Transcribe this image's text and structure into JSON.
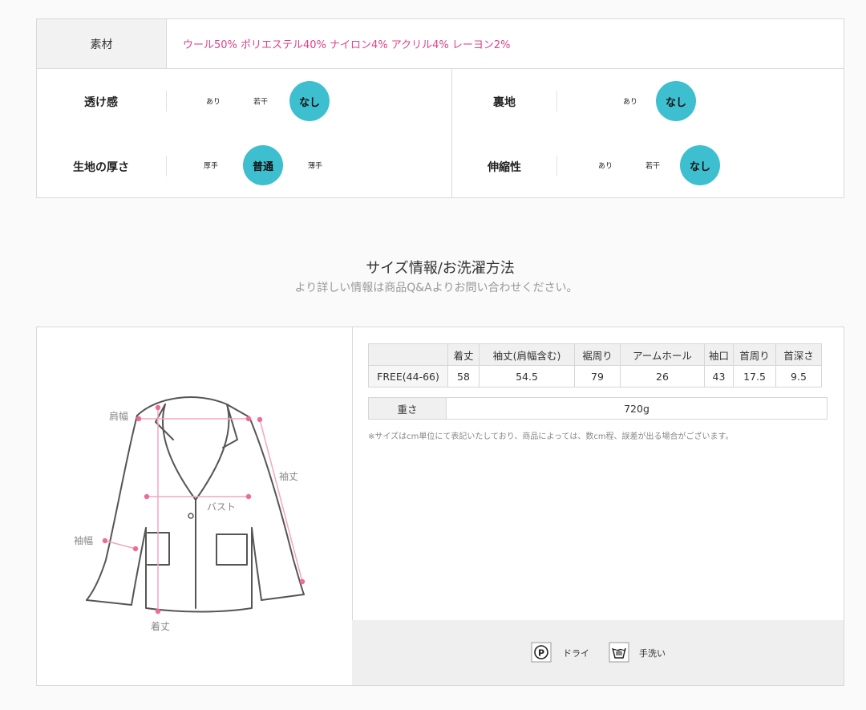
{
  "material": {
    "label": "素材",
    "value": "ウール50% ポリエステル40% ナイロン4% アクリル4% レーヨン2%"
  },
  "attributes": [
    {
      "label": "透け感",
      "options": [
        "あり",
        "若干",
        "なし"
      ],
      "selected": "なし"
    },
    {
      "label": "裏地",
      "options": [
        "あり",
        "なし"
      ],
      "selected": "なし"
    },
    {
      "label": "生地の厚さ",
      "options": [
        "厚手",
        "普通",
        "薄手"
      ],
      "selected": "普通"
    },
    {
      "label": "伸縮性",
      "options": [
        "あり",
        "若干",
        "なし"
      ],
      "selected": "なし"
    }
  ],
  "section": {
    "title": "サイズ情報/お洗濯方法",
    "subtitle": "より詳しい情報は商品Q&Aよりお問い合わせください。"
  },
  "diagram_labels": {
    "shoulder": "肩幅",
    "sleeve_length": "袖丈",
    "bust": "バスト",
    "sleeve_width": "袖幅",
    "length": "着丈"
  },
  "size_table": {
    "headers": [
      "",
      "着丈",
      "袖丈(肩幅含む)",
      "裾周り",
      "アームホール",
      "袖口",
      "首周り",
      "首深さ"
    ],
    "rows": [
      [
        "FREE(44-66)",
        "58",
        "54.5",
        "79",
        "26",
        "43",
        "17.5",
        "9.5"
      ]
    ]
  },
  "weight": {
    "label": "重さ",
    "value": "720g"
  },
  "note": "※サイズはcm単位にて表記いたしており、商品によっては、数cm程、誤差が出る場合がございます。",
  "care": [
    {
      "icon": "dry-clean-p-icon",
      "label": "ドライ"
    },
    {
      "icon": "hand-wash-icon",
      "label": "手洗い"
    }
  ],
  "colors": {
    "accent": "#3dbfd0",
    "material_text": "#e0408a",
    "diagram_marker": "#f06a9a"
  }
}
